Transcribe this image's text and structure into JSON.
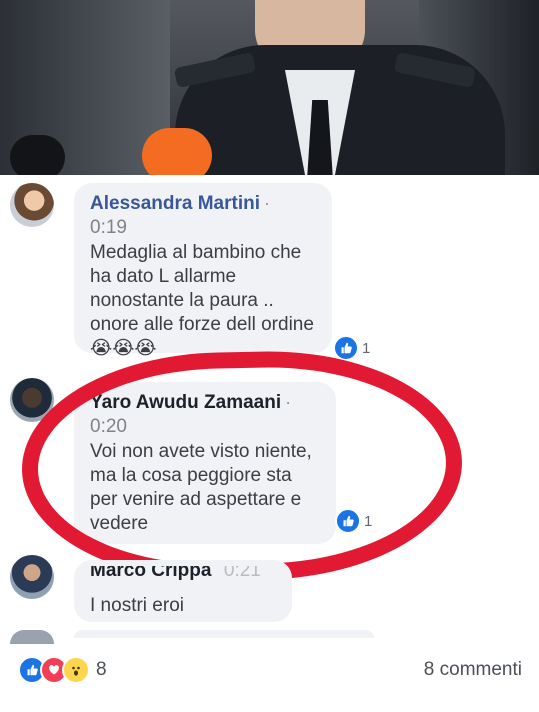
{
  "comments": [
    {
      "author": "Alessandra Martini",
      "separator": "·",
      "time": "0:19",
      "text": "Medaglia al bambino che ha dato L allarme nonostante la paura .. onore alle forze dell ordine",
      "emoji": "😭😭😭",
      "likes": "1"
    },
    {
      "author": "Yaro Awudu Zamaani",
      "separator": "·",
      "time": "0:20",
      "text": "Voi non avete visto niente, ma la cosa peggiore sta per venire ad aspettare e vedere",
      "likes": "1"
    },
    {
      "author": "Marco Crippa",
      "time": "0:21",
      "text": "I nostri eroi"
    }
  ],
  "footer": {
    "reaction_count": "8",
    "comments_count": "8 commenti"
  },
  "colors": {
    "link": "#385898",
    "highlight": "#e21932",
    "like_blue": "#1b74e4"
  }
}
